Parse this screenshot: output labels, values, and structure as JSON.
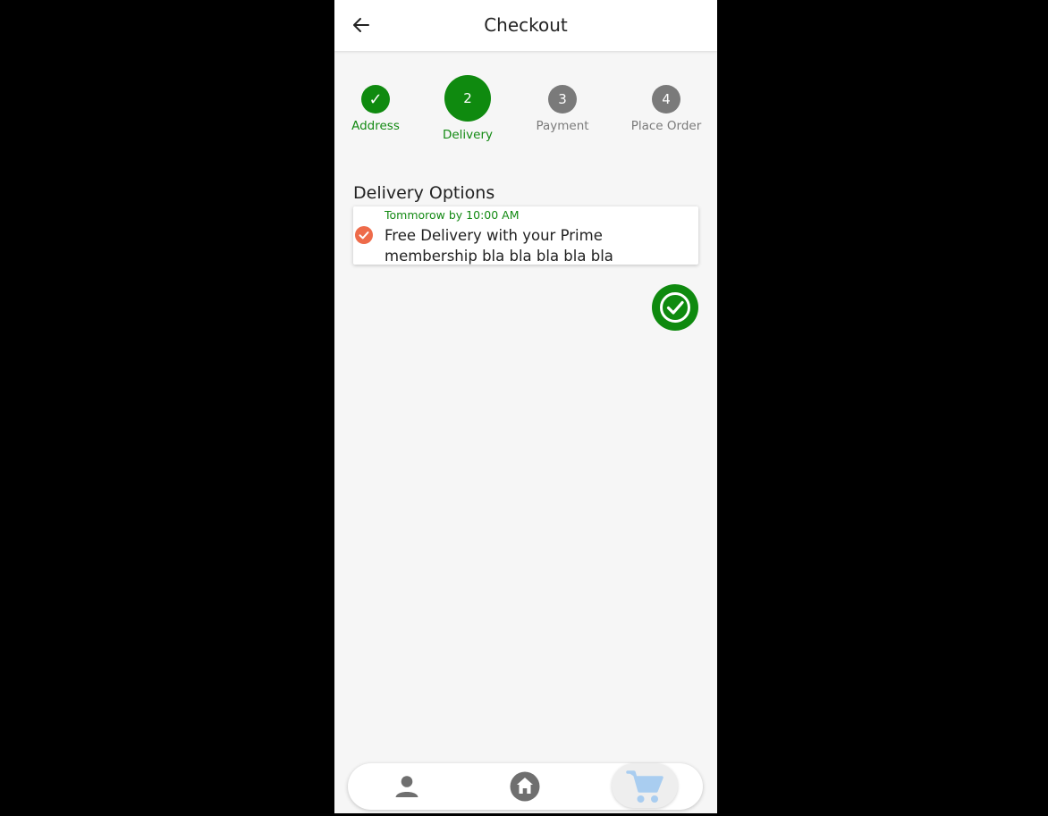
{
  "appbar": {
    "title": "Checkout"
  },
  "steps": [
    {
      "label": "Address",
      "badge": "✓",
      "state": "done"
    },
    {
      "label": "Delivery",
      "badge": "2",
      "state": "current"
    },
    {
      "label": "Payment",
      "badge": "3",
      "state": "upcoming"
    },
    {
      "label": "Place Order",
      "badge": "4",
      "state": "upcoming"
    }
  ],
  "delivery": {
    "section_title": "Delivery Options",
    "options": [
      {
        "time": "Tommorow by 10:00 AM",
        "description": "Free Delivery with your Prime membership bla bla bla bla bla",
        "selected": true
      }
    ]
  },
  "bottom_nav": {
    "items": [
      {
        "icon": "person-icon"
      },
      {
        "icon": "home-icon"
      },
      {
        "icon": "shopping-cart-icon",
        "active": true
      }
    ]
  },
  "colors": {
    "primary_green": "#0f8a0f",
    "inactive_gray": "#7a7a7a",
    "selected_check": "#ee6b4a",
    "cart_active": "#a9cdf0"
  }
}
